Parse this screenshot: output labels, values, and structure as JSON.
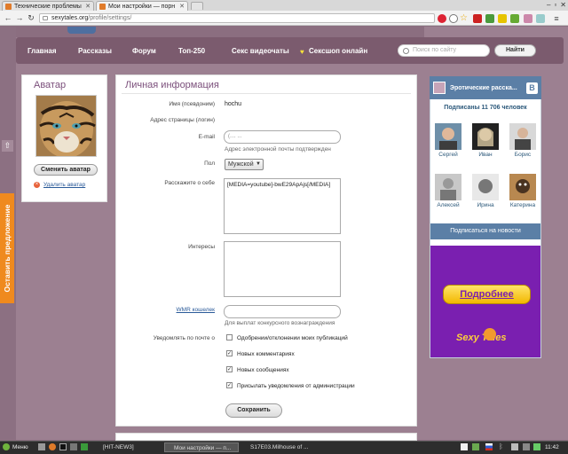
{
  "browser": {
    "tabs": [
      {
        "title": "Технические проблемы",
        "active": false,
        "fav_color": "#e07b2a"
      },
      {
        "title": "Мои настройки — порн",
        "active": true,
        "fav_color": "#e07b2a"
      }
    ],
    "url_host": "sexytales.org",
    "url_path": "/profile/settings/"
  },
  "site": {
    "nav": [
      "Главная",
      "Рассказы",
      "Форум",
      "Топ-250",
      "Секс видеочаты",
      "Сексшоп онлайн"
    ],
    "search_placeholder": "Поиск по сайту",
    "search_button": "Найти"
  },
  "avatar_panel": {
    "title": "Аватар",
    "change_button": "Сменить аватар",
    "delete_link": "Удалить аватар"
  },
  "personal": {
    "title": "Личная информация",
    "username_label": "Имя (псевдоним)",
    "username_value": "hochu",
    "page_label": "Адрес страницы (логин)",
    "email_label": "E-mail",
    "email_value": "(.... ...",
    "email_hint": "Адрес электронной почты подтвержден",
    "gender_label": "Пол",
    "gender_value": "Мужской",
    "about_label": "Расскажите о себе",
    "about_value": "[MEDIA=youtube]-bwE29ApAjs[/MEDIA]",
    "interests_label": "Интересы",
    "wmr_label": "WMR кошелек",
    "wmr_hint": "Для выплат конкурсного вознаграждения",
    "notify_label": "Уведомлять по почте о",
    "notify_options": [
      {
        "label": "Одобрении/отклонении моих публикаций",
        "checked": false
      },
      {
        "label": "Новых комментариях",
        "checked": true
      },
      {
        "label": "Новых сообщениях",
        "checked": true
      },
      {
        "label": "Присылать уведомления от администрации",
        "checked": true
      }
    ],
    "save_button": "Сохранить"
  },
  "vk_widget": {
    "group_name": "Эротические расска...",
    "logo": "В",
    "subscribers": "Подписаны 11 706 человек",
    "members": [
      "Сергей",
      "Иван",
      "Борис",
      "Алексей",
      "Ирина",
      "Катерина"
    ],
    "subscribe_button": "Подписаться на новости"
  },
  "promo": {
    "button": "Подробнее",
    "brand": "Sexy Tales"
  },
  "side_tab": "Оставить предложение",
  "taskbar": {
    "menu": "Меню",
    "tasks": [
      "[HIT-NEW3]",
      "Мои настройки — п...",
      "S17E03.Milhouse of ..."
    ],
    "clock": "11:42"
  }
}
